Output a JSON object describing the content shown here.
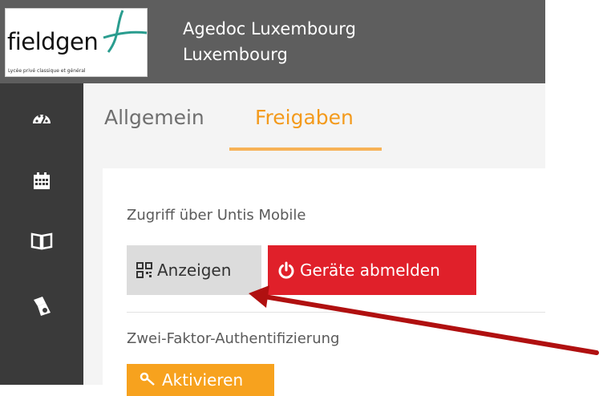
{
  "header": {
    "logo_text": "fieldgen",
    "logo_subtitle": "Lycée privé classique et général",
    "school_name": "Agedoc Luxembourg",
    "school_city": "Luxembourg"
  },
  "sidebar": {
    "items": [
      {
        "icon": "dashboard-icon"
      },
      {
        "icon": "calendar-icon"
      },
      {
        "icon": "book-icon"
      },
      {
        "icon": "hand-stamp-icon"
      }
    ]
  },
  "tabs": [
    {
      "label": "Allgemein",
      "active": false
    },
    {
      "label": "Freigaben",
      "active": true
    }
  ],
  "sections": {
    "mobile_label": "Zugriff über Untis Mobile",
    "show_button": "Anzeigen",
    "logout_button": "Geräte abmelden",
    "twofa_label": "Zwei-Faktor-Authentifizierung",
    "activate_button": "Aktivieren"
  },
  "colors": {
    "accent": "#f39a1c",
    "danger": "#e0202a",
    "header": "#5e5e5e",
    "sidebar": "#3a3a3a",
    "arrow": "#b01010"
  }
}
